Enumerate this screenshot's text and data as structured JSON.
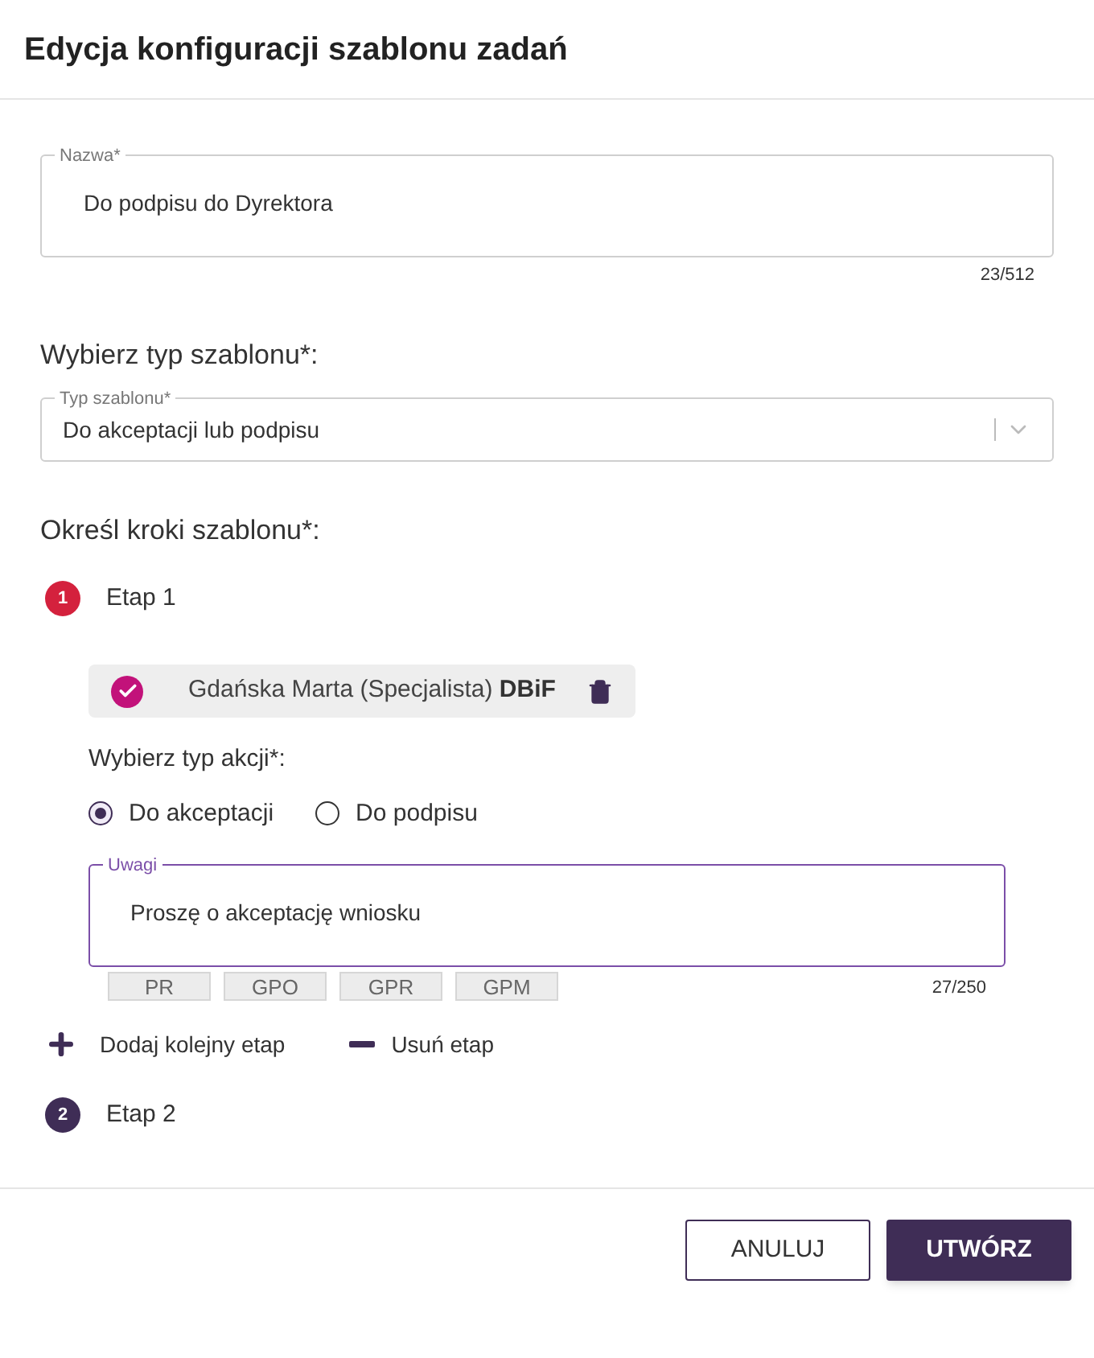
{
  "dialog": {
    "title": "Edycja konfiguracji szablonu zadań"
  },
  "name_field": {
    "label": "Nazwa",
    "required_mark": "*",
    "value": "Do podpisu do Dyrektora",
    "counter": "23/512"
  },
  "template_type": {
    "heading": "Wybierz typ szablonu*:",
    "label": "Typ szablonu",
    "required_mark": "*",
    "value": "Do akceptacji lub podpisu"
  },
  "steps_heading": "Określ kroki szablonu*:",
  "steps": [
    {
      "number": "1",
      "label": "Etap 1",
      "active": true,
      "assignee": {
        "name": "Gdańska Marta (Specjalista)",
        "unit": "DBiF",
        "checked": true
      },
      "action_heading": "Wybierz typ akcji*:",
      "actions": [
        {
          "label": "Do akceptacji",
          "selected": true
        },
        {
          "label": "Do podpisu",
          "selected": false
        }
      ],
      "notes": {
        "label": "Uwagi",
        "value": "Proszę o akceptację wniosku",
        "counter": "27/250",
        "tags": [
          "PR",
          "GPO",
          "GPR",
          "GPM"
        ]
      },
      "add_label": "Dodaj kolejny etap",
      "remove_label": "Usuń etap"
    },
    {
      "number": "2",
      "label": "Etap 2",
      "active": false
    }
  ],
  "buttons": [
    {
      "label": "ANULUJ",
      "kind": "secondary"
    },
    {
      "label": "UTWÓRZ",
      "kind": "primary"
    }
  ]
}
